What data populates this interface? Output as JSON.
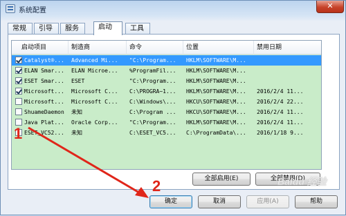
{
  "window": {
    "title": "系统配置",
    "close_label": "✕"
  },
  "tabs": [
    {
      "label": "常规",
      "active": false
    },
    {
      "label": "引导",
      "active": false
    },
    {
      "label": "服务",
      "active": false
    },
    {
      "label": "启动",
      "active": true
    },
    {
      "label": "工具",
      "active": false
    }
  ],
  "columns": [
    "启动项目",
    "制造商",
    "命令",
    "位置",
    "禁用日期"
  ],
  "rows": [
    {
      "checked": true,
      "selected": true,
      "item": "Catalyst®...",
      "maker": "Advanced Mi...",
      "command": "\"C:\\Program...",
      "location": "HKLM\\SOFTWARE\\M...",
      "date": ""
    },
    {
      "checked": true,
      "selected": false,
      "item": "ELAN Smar...",
      "maker": "ELAN Microe...",
      "command": "%ProgramFil...",
      "location": "HKLM\\SOFTWARE\\M...",
      "date": ""
    },
    {
      "checked": true,
      "selected": false,
      "item": "ESET Smar...",
      "maker": "ESET",
      "command": "\"C:\\Program...",
      "location": "HKLM\\SOFTWARE\\M...",
      "date": ""
    },
    {
      "checked": true,
      "selected": false,
      "item": "Microsoft...",
      "maker": "Microsoft C...",
      "command": "C:\\PROGRA~1...",
      "location": "HKLM\\SOFTWARE\\M...",
      "date": "2016/2/4 11..."
    },
    {
      "checked": false,
      "selected": false,
      "item": "Microsoft...",
      "maker": "Microsoft C...",
      "command": "C:\\Windows\\...",
      "location": "HKCU\\SOFTWARE\\M...",
      "date": "2016/2/4 22..."
    },
    {
      "checked": false,
      "selected": false,
      "item": "ShuameDaemon",
      "maker": "未知",
      "command": "C:\\Program ...",
      "location": "HKCU\\SOFTWARE\\M...",
      "date": "2016/2/4 11..."
    },
    {
      "checked": false,
      "selected": false,
      "item": "Java Plat...",
      "maker": "Oracle Corp...",
      "command": "\"C:\\Program...",
      "location": "HKLM\\SOFTWARE\\M...",
      "date": "2016/2/4 11..."
    },
    {
      "checked": false,
      "selected": false,
      "item": "ESET_VC52...",
      "maker": "未知",
      "command": "C:\\ESET_VC5...",
      "location": "C:\\ProgramData\\...",
      "date": "2016/1/18 9..."
    }
  ],
  "buttons": {
    "enable_all": "全部启用(E)",
    "disable_all": "全部禁用(D)",
    "ok": "确定",
    "cancel": "取消",
    "apply": "应用(A)",
    "help": "帮助"
  },
  "annotations": {
    "first": "1",
    "second": "2"
  },
  "watermark": "Baidu 经验"
}
